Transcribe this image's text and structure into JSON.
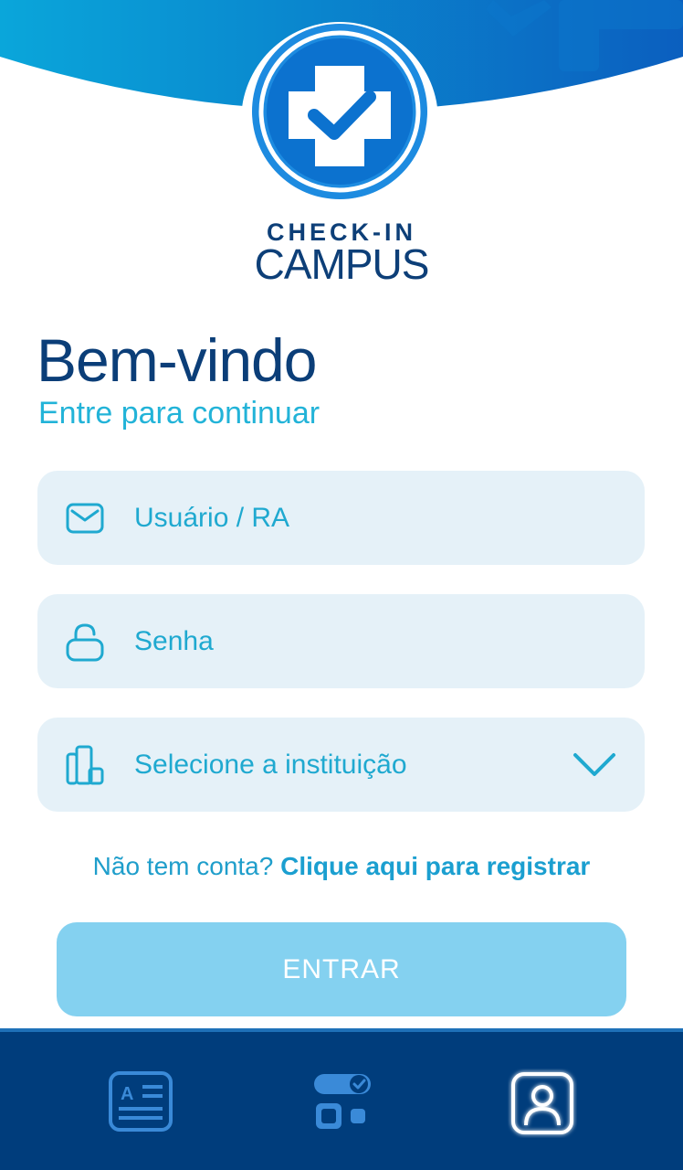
{
  "brand": {
    "line1": "CHECK-IN",
    "line2": "CAMPUS"
  },
  "welcome": {
    "title": "Bem-vindo",
    "subtitle": "Entre para continuar"
  },
  "form": {
    "user_placeholder": "Usuário / RA",
    "password_placeholder": "Senha",
    "institution_placeholder": "Selecione a instituição"
  },
  "register": {
    "prompt": "Não tem conta?",
    "link": "Clique aqui para registrar"
  },
  "submit_label": "ENTRAR",
  "nav": {
    "items": [
      {
        "icon": "id-card-icon"
      },
      {
        "icon": "checkin-toggle-icon"
      },
      {
        "icon": "profile-icon"
      }
    ]
  },
  "colors": {
    "primary_dark": "#0b3e78",
    "accent": "#22b3d8",
    "field_bg": "#e5f1f8",
    "button_bg": "#84d1f0",
    "nav_bg": "#003d7c"
  }
}
